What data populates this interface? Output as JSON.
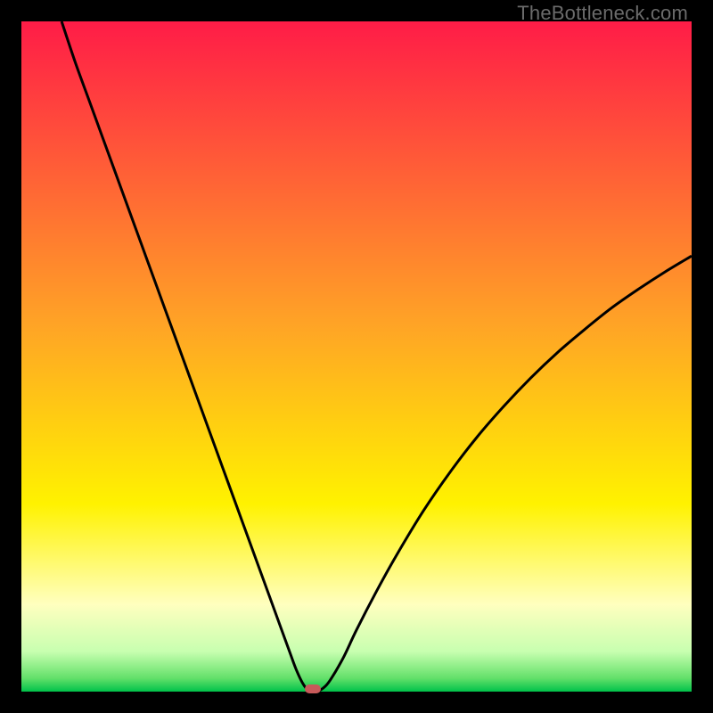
{
  "watermark": "TheBottleneck.com",
  "marker": {
    "color": "#c75a5a"
  },
  "chart_data": {
    "type": "line",
    "title": "",
    "xlabel": "",
    "ylabel": "",
    "xlim": [
      0,
      100
    ],
    "ylim": [
      0,
      100
    ],
    "background_gradient_stops": [
      {
        "pos": 0.0,
        "color": "#ff1c47"
      },
      {
        "pos": 0.45,
        "color": "#ffa326"
      },
      {
        "pos": 0.72,
        "color": "#fff200"
      },
      {
        "pos": 0.87,
        "color": "#ffffbf"
      },
      {
        "pos": 0.94,
        "color": "#c8ffb0"
      },
      {
        "pos": 0.98,
        "color": "#63e06a"
      },
      {
        "pos": 1.0,
        "color": "#00c24a"
      }
    ],
    "optimum_x": 43,
    "series": [
      {
        "name": "bottleneck-curve",
        "x": [
          6,
          8,
          10,
          12,
          14,
          16,
          18,
          20,
          22,
          24,
          26,
          28,
          30,
          32,
          34,
          36,
          38,
          40,
          41,
          42,
          43,
          44,
          45,
          46,
          48,
          50,
          53,
          56,
          60,
          64,
          68,
          72,
          76,
          80,
          84,
          88,
          92,
          96,
          100
        ],
        "y": [
          100,
          94,
          88.5,
          83,
          77.5,
          72,
          66.5,
          61,
          55.5,
          50,
          44.5,
          39,
          33.5,
          28,
          22.5,
          17,
          11.5,
          6,
          3.3,
          1.2,
          0,
          0,
          0.5,
          1.6,
          5,
          9.2,
          15,
          20.4,
          27,
          32.8,
          38,
          42.6,
          46.8,
          50.6,
          54,
          57.2,
          60,
          62.6,
          65
        ]
      }
    ],
    "marker_point": {
      "x": 43.5,
      "y": 0
    }
  }
}
